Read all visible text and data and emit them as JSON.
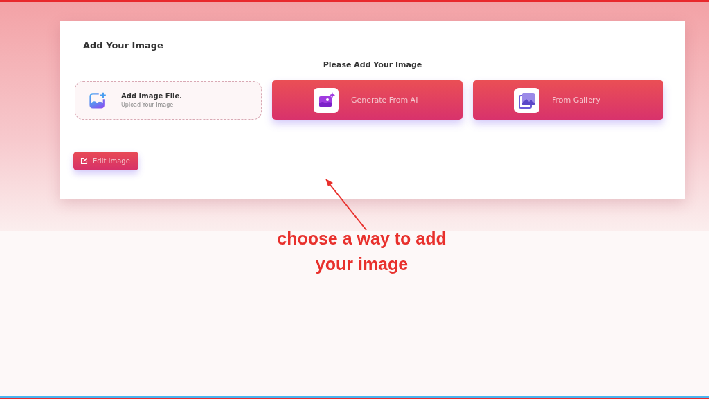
{
  "card": {
    "title": "Add Your Image",
    "subtitle": "Please Add Your Image",
    "options": [
      {
        "kind": "upload",
        "label": "Add Image File.",
        "hint": "Upload Your Image"
      },
      {
        "kind": "ai",
        "label": "Generate From AI"
      },
      {
        "kind": "gallery",
        "label": "From Gallery"
      }
    ],
    "edit_button": "Edit Image"
  },
  "annotation": {
    "text": "choose a way to add your image"
  }
}
